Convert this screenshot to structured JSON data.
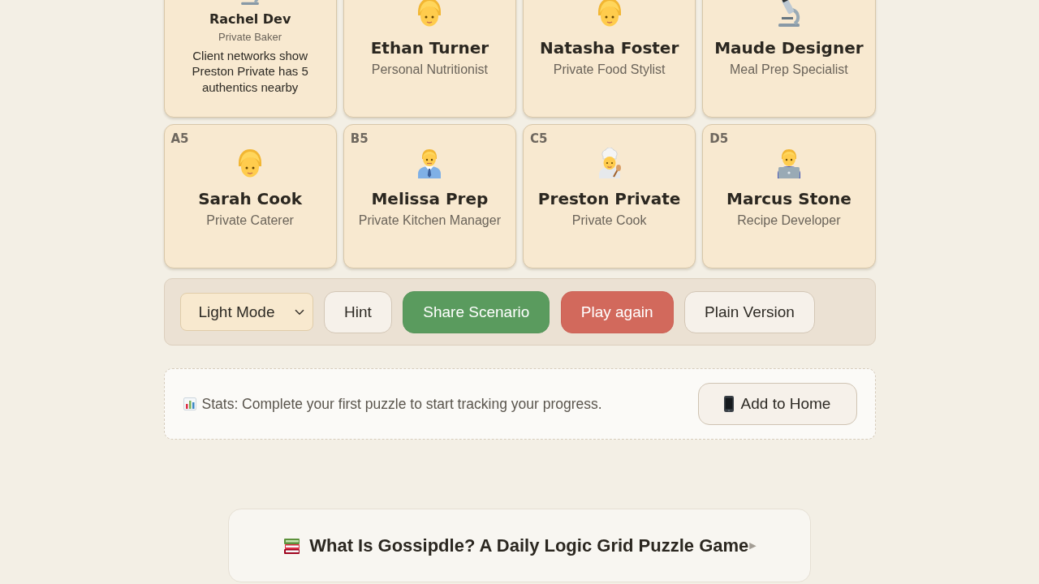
{
  "cards": [
    {
      "name": "Rachel Dev",
      "role": "Private Baker",
      "clue": "Client networks show Preston Private has 5 authentics nearby",
      "kind": "microscope"
    },
    {
      "name": "Ethan Turner",
      "role": "Personal Nutritionist",
      "kind": "person"
    },
    {
      "name": "Natasha Foster",
      "role": "Private Food Stylist",
      "kind": "person"
    },
    {
      "name": "Maude Designer",
      "role": "Meal Prep Specialist",
      "kind": "microscope"
    },
    {
      "label": "A5",
      "name": "Sarah Cook",
      "role": "Private Caterer",
      "kind": "person"
    },
    {
      "label": "B5",
      "name": "Melissa Prep",
      "role": "Private Kitchen Manager",
      "kind": "office-worker"
    },
    {
      "label": "C5",
      "name": "Preston Private",
      "role": "Private Cook",
      "kind": "cook"
    },
    {
      "label": "D5",
      "name": "Marcus Stone",
      "role": "Recipe Developer",
      "kind": "technologist"
    }
  ],
  "controls": [
    {
      "kind": "select",
      "label": "Light Mode"
    },
    {
      "kind": "plain",
      "label": "Hint"
    },
    {
      "kind": "success",
      "label": "Share Scenario"
    },
    {
      "kind": "danger",
      "label": "Play again"
    },
    {
      "kind": "plain",
      "label": "Plain Version"
    }
  ],
  "stats": {
    "text": "Stats: Complete your first puzzle to start tracking your progress.",
    "button": "Add to Home"
  },
  "about": {
    "title": "What Is Gossipdle? A Daily Logic Grid Puzzle Game",
    "marker": "▶"
  }
}
